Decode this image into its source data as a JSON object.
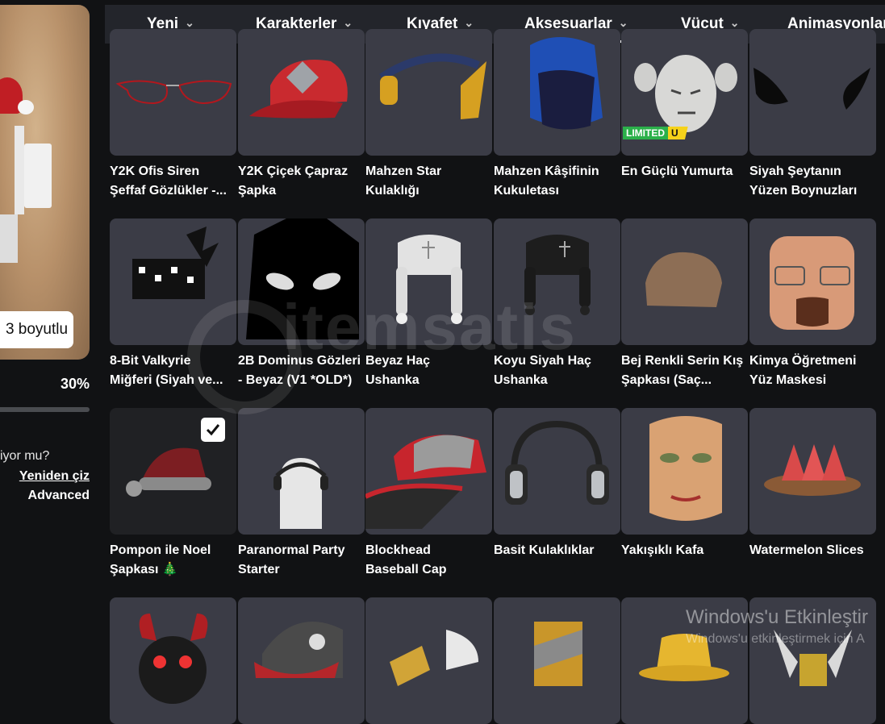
{
  "left_panel": {
    "view_3d_label": "3 boyutlu",
    "progress_label": "30%",
    "progress_fraction": 0.3,
    "question_text": "iyor mu?",
    "redraw_label": "Yeniden çiz",
    "advanced_label": "Advanced"
  },
  "nav": {
    "tabs": [
      {
        "label": "Yeni",
        "chevron": "⌄"
      },
      {
        "label": "Karakterler",
        "chevron": "⌄"
      },
      {
        "label": "Kıyafet",
        "chevron": "⌄"
      },
      {
        "label": "Aksesuarlar",
        "chevron": "⌄"
      },
      {
        "label": "Vücut",
        "chevron": "⌄"
      },
      {
        "label": "Animasyonlar"
      }
    ],
    "active_tab": "Aksesuarlar"
  },
  "items": {
    "row1": [
      {
        "line1": "Y2K Ofis Siren",
        "line2": "Şeffaf Gözlükler -..."
      },
      {
        "line1": "Y2K Çiçek Çapraz",
        "line2": "Şapka"
      },
      {
        "line1": "Mahzen Star",
        "line2": "Kulaklığı"
      },
      {
        "line1": "Mahzen Kâşifinin",
        "line2": "Kukuletası"
      },
      {
        "line1": "En Güçlü Yumurta",
        "line2": ""
      },
      {
        "line1": "Siyah Şeytanın",
        "line2": "Yüzen Boynuzları"
      }
    ],
    "row2": [
      {
        "line1": "8-Bit Valkyrie",
        "line2": "Miğferi (Siyah ve..."
      },
      {
        "line1": "2B Dominus Gözleri",
        "line2": "- Beyaz (V1 *OLD*)"
      },
      {
        "line1": "Beyaz Haç",
        "line2": "Ushanka"
      },
      {
        "line1": "Koyu Siyah Haç",
        "line2": "Ushanka"
      },
      {
        "line1": "Bej Renkli Serin Kış",
        "line2": "Şapkası (Saç..."
      },
      {
        "line1": "Kimya Öğretmeni",
        "line2": "Yüz Maskesi"
      }
    ],
    "row3": [
      {
        "line1": "Pompon ile Noel",
        "line2": "Şapkası 🎄"
      },
      {
        "line1": "Paranormal Party",
        "line2": "Starter"
      },
      {
        "line1": "Blockhead",
        "line2": "Baseball Cap"
      },
      {
        "line1": "Basit Kulaklıklar",
        "line2": ""
      },
      {
        "line1": "Yakışıklı Kafa",
        "line2": ""
      },
      {
        "line1": "Watermelon Slices",
        "line2": ""
      }
    ]
  },
  "badges": {
    "limited_text": "LIMITED",
    "limited_u": "U"
  },
  "overlay": {
    "watermark": "itemsatis",
    "windows_title": "Windows'u Etkinleştir",
    "windows_sub": "Windows'u etkinleştirmek için A"
  },
  "icons": {
    "check": "checkmark-icon",
    "chevron": "chevron-down-icon"
  },
  "colors": {
    "background": "#111214",
    "nav": "#23252b",
    "card": "#3b3c46",
    "limited_green": "#2bb04a",
    "limited_yellow": "#f6d21a"
  }
}
